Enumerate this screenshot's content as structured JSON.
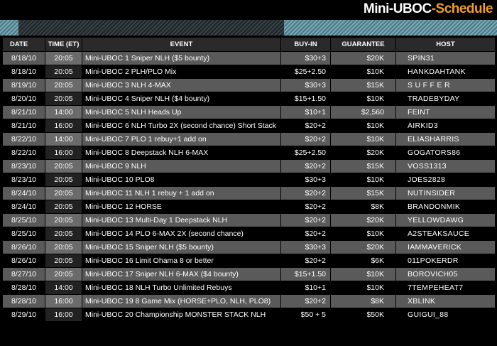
{
  "header": {
    "title_main": "Mini-UBOC",
    "title_sub": "-Schedule"
  },
  "columns": {
    "date": "DATE",
    "time": "TIME (ET)",
    "event": "EVENT",
    "buyin": "BUY-IN",
    "guarantee": "GUARANTEE",
    "host": "HOST"
  },
  "rows": [
    {
      "date": "8/18/10",
      "time": "20:05",
      "event": "Mini-UBOC 1 Sniper NLH ($5 bounty)",
      "buyin": "$30+3",
      "guarantee": "$20K",
      "host": "SPIN31"
    },
    {
      "date": "8/18/10",
      "time": "20:05",
      "event": "Mini-UBOC 2 PLH/PLO Mix",
      "buyin": "$25+2.50",
      "guarantee": "$10K",
      "host": "HANKDAHTANK"
    },
    {
      "date": "8/19/10",
      "time": "20:05",
      "event": "Mini-UBOC 3 NLH 4-MAX",
      "buyin": "$30+3",
      "guarantee": "$15K",
      "host": "S U F F E R"
    },
    {
      "date": "8/20/10",
      "time": "20:05",
      "event": "Mini-UBOC 4 Sniper NLH ($4 bounty)",
      "buyin": "$15+1.50",
      "guarantee": "$10K",
      "host": "TRADEBYDAY"
    },
    {
      "date": "8/21/10",
      "time": "14:00",
      "event": "Mini-UBOC 5 NLH Heads Up",
      "buyin": "$10+1",
      "guarantee": "$2,560",
      "host": "FEINT"
    },
    {
      "date": "8/21/10",
      "time": "16:00",
      "event": "Mini-UBOC 6 NLH Turbo 2X (second chance) Short Stack",
      "buyin": "$20+2",
      "guarantee": "$10K",
      "host": "AIRKID3"
    },
    {
      "date": "8/22/10",
      "time": "14:00",
      "event": "Mini-UBOC 7 PLO 1 rebuy+1 add on",
      "buyin": "$20+2",
      "guarantee": "$10K",
      "host": "ELIASHARRIS"
    },
    {
      "date": "8/22/10",
      "time": "16:00",
      "event": "Mini-UBOC 8 Deepstack NLH 6-MAX",
      "buyin": "$25+2.50",
      "guarantee": "$20K",
      "host": "GOGATORS86"
    },
    {
      "date": "8/23/10",
      "time": "20:05",
      "event": "Mini-UBOC 9 NLH",
      "buyin": "$20+2",
      "guarantee": "$15K",
      "host": "VOSS1313"
    },
    {
      "date": "8/23/10",
      "time": "20:05",
      "event": "Mini-UBOC 10 PLO8",
      "buyin": "$30+3",
      "guarantee": "$10K",
      "host": "JOES2828"
    },
    {
      "date": "8/24/10",
      "time": "20:05",
      "event": "Mini-UBOC 11 NLH 1 rebuy + 1 add on",
      "buyin": "$20+2",
      "guarantee": "$15K",
      "host": "NUTINSIDER"
    },
    {
      "date": "8/24/10",
      "time": "20:05",
      "event": "Mini-UBOC 12 HORSE",
      "buyin": "$20+2",
      "guarantee": "$8K",
      "host": "BRANDONMIK"
    },
    {
      "date": "8/25/10",
      "time": "20:05",
      "event": "Mini-UBOC 13 Multi-Day 1 Deepstack NLH",
      "buyin": "$20+2",
      "guarantee": "$20K",
      "host": "YELLOWDAWG"
    },
    {
      "date": "8/25/10",
      "time": "20:05",
      "event": "Mini-UBOC 14 PLO 6-MAX 2X (second chance)",
      "buyin": "$20+2",
      "guarantee": "$10K",
      "host": "A2STEAKSAUCE"
    },
    {
      "date": "8/26/10",
      "time": "20:05",
      "event": "Mini-UBOC 15 Sniper NLH ($5 bounty)",
      "buyin": "$30+3",
      "guarantee": "$20K",
      "host": "IAMMAVERICK"
    },
    {
      "date": "8/26/10",
      "time": "20:05",
      "event": "Mini-UBOC 16 Limit Ohama 8 or better",
      "buyin": "$20+2",
      "guarantee": "$6K",
      "host": "011POKERDR"
    },
    {
      "date": "8/27/10",
      "time": "20:05",
      "event": "Mini-UBOC 17 Sniper NLH 6-MAX ($4 bounty)",
      "buyin": "$15+1.50",
      "guarantee": "$10K",
      "host": "BOROVICH05"
    },
    {
      "date": "8/28/10",
      "time": "14:00",
      "event": "Mini-UBOC 18 NLH Turbo Unlimited Rebuys",
      "buyin": "$10+1",
      "guarantee": "$10K",
      "host": "7TEMPEHEAT7"
    },
    {
      "date": "8/28/10",
      "time": "16:00",
      "event": "Mini-UBOC 19 8 Game Mix (HORSE+PLO, NLH, PLO8)",
      "buyin": "$20+2",
      "guarantee": "$8K",
      "host": "XBLINK"
    },
    {
      "date": "8/29/10",
      "time": "16:00",
      "event": "Mini-UBOC 20 Championship MONSTER STACK NLH",
      "buyin": "$50 + 5",
      "guarantee": "$50K",
      "host": "GUIGUI_88"
    }
  ],
  "colors": {
    "accent": "#f0a020",
    "row_odd": "#5a5a5a",
    "row_even": "#000000"
  }
}
